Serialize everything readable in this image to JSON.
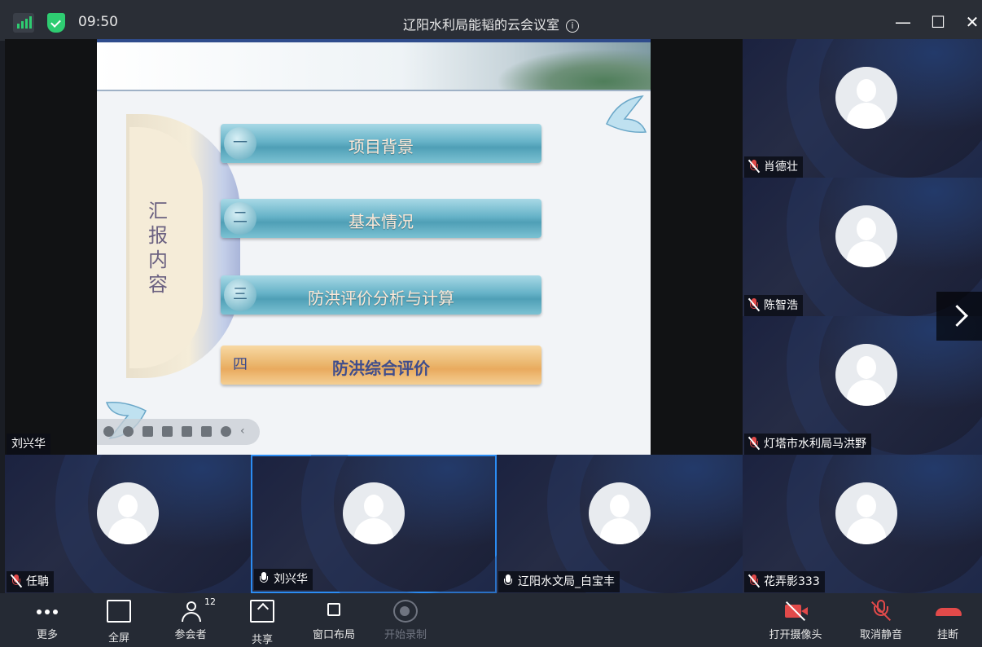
{
  "window": {
    "time": "09:50",
    "title": "辽阳水利局能韬的云会议室",
    "info_icon": "ⓘ",
    "controls": {
      "minimize": "—",
      "maximize": "☐",
      "close": "✕"
    }
  },
  "presenter": {
    "name": "刘兴华"
  },
  "slide": {
    "side_text": "汇报内容",
    "items": [
      {
        "num": "一",
        "label": "项目背景"
      },
      {
        "num": "二",
        "label": "基本情况"
      },
      {
        "num": "三",
        "label": "防洪评价分析与计算"
      },
      {
        "num": "四",
        "label": "防洪综合评价"
      }
    ]
  },
  "side_tiles": [
    {
      "name": "肖德壮",
      "muted": true
    },
    {
      "name": "陈智浩",
      "muted": true
    },
    {
      "name": "灯塔市水利局马洪野",
      "muted": true
    }
  ],
  "bottom_tiles": [
    {
      "name": "任聃",
      "muted": true
    },
    {
      "name": "刘兴华",
      "muted": false
    },
    {
      "name": "辽阳水文局_白宝丰",
      "muted": false
    },
    {
      "name": "花弄影333",
      "muted": true
    }
  ],
  "toolbar": {
    "more": "更多",
    "fullscreen": "全屏",
    "participants": "参会者",
    "participant_count": "12",
    "share": "共享",
    "layout": "窗口布局",
    "record": "开始录制",
    "camera": "打开摄像头",
    "unmute": "取消静音",
    "hangup": "挂断"
  },
  "colors": {
    "accent": "#2b8cf3",
    "danger": "#e24a4a",
    "secure": "#2ecc71"
  }
}
